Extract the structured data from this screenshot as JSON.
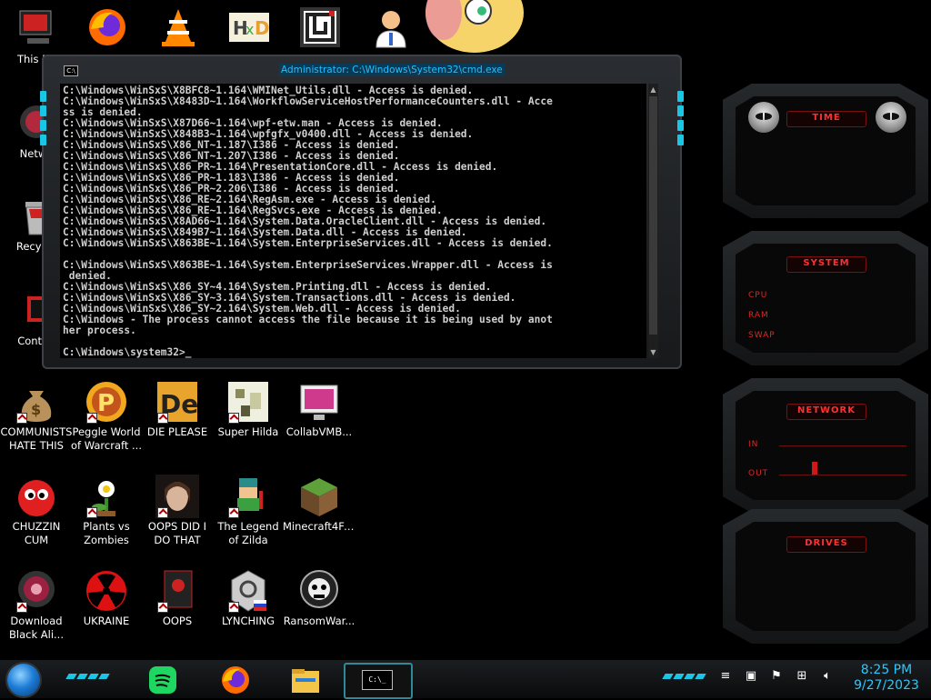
{
  "desktop": {
    "top_row_partial": [
      {
        "label": "This PC",
        "icon": "this-pc-icon"
      },
      {
        "label": "",
        "icon": "firefox-icon"
      },
      {
        "label": "",
        "icon": "vlc-icon"
      },
      {
        "label": "",
        "icon": "hxd-icon"
      },
      {
        "label": "",
        "icon": "maze-icon"
      },
      {
        "label": "",
        "icon": "doctor-icon"
      },
      {
        "label": "",
        "icon": "cartoon-character-icon"
      }
    ],
    "left_column": [
      {
        "label": "Netwo",
        "icon": "network-icon"
      },
      {
        "label": "Recycle",
        "icon": "recycle-bin-icon"
      },
      {
        "label": "Control",
        "icon": "control-panel-icon"
      }
    ],
    "grid": [
      {
        "label": "COMMUNISTS HATE THIS G...",
        "icon": "money-bag-icon"
      },
      {
        "label": "Peggle World of Warcraft ...",
        "icon": "peggle-icon"
      },
      {
        "label": "DIE PLEASE",
        "icon": "die-icon"
      },
      {
        "label": "Super Hilda",
        "icon": "super-hilda-icon"
      },
      {
        "label": "CollabVMB...",
        "icon": "collabvm-icon"
      },
      {
        "label": "CHUZZIN CUM",
        "icon": "chuzzle-icon"
      },
      {
        "label": "Plants vs Zombies",
        "icon": "plants-vs-zombies-icon"
      },
      {
        "label": "OOPS DID I DO THAT",
        "icon": "portrait-icon"
      },
      {
        "label": "The Legend of Zilda",
        "icon": "zelda-icon"
      },
      {
        "label": "Minecraft4Fr...",
        "icon": "minecraft-icon"
      },
      {
        "label": "Download Black Ali...",
        "icon": "alienware-icon"
      },
      {
        "label": "UKRAINE",
        "icon": "radiation-icon"
      },
      {
        "label": "OOPS",
        "icon": "oops-icon"
      },
      {
        "label": "LYNCHING",
        "icon": "lynching-icon"
      },
      {
        "label": "RansomWar...",
        "icon": "skull-icon"
      }
    ]
  },
  "console": {
    "title": "Administrator: C:\\Windows\\System32\\cmd.exe",
    "icon_label": "C:\\",
    "lines": [
      "C:\\Windows\\WinSxS\\X8BFC8~1.164\\WMINet_Utils.dll - Access is denied.",
      "C:\\Windows\\WinSxS\\X8483D~1.164\\WorkflowServiceHostPerformanceCounters.dll - Acce",
      "ss is denied.",
      "C:\\Windows\\WinSxS\\X87D66~1.164\\wpf-etw.man - Access is denied.",
      "C:\\Windows\\WinSxS\\X848B3~1.164\\wpfgfx_v0400.dll - Access is denied.",
      "C:\\Windows\\WinSxS\\X86_NT~1.187\\I386 - Access is denied.",
      "C:\\Windows\\WinSxS\\X86_NT~1.207\\I386 - Access is denied.",
      "C:\\Windows\\WinSxS\\X86_PR~1.164\\PresentationCore.dll - Access is denied.",
      "C:\\Windows\\WinSxS\\X86_PR~1.183\\I386 - Access is denied.",
      "C:\\Windows\\WinSxS\\X86_PR~2.206\\I386 - Access is denied.",
      "C:\\Windows\\WinSxS\\X86_RE~2.164\\RegAsm.exe - Access is denied.",
      "C:\\Windows\\WinSxS\\X86_RE~1.164\\RegSvcs.exe - Access is denied.",
      "C:\\Windows\\WinSxS\\X8AD66~1.164\\System.Data.OracleClient.dll - Access is denied.",
      "C:\\Windows\\WinSxS\\X849B7~1.164\\System.Data.dll - Access is denied.",
      "C:\\Windows\\WinSxS\\X863BE~1.164\\System.EnterpriseServices.dll - Access is denied.",
      "",
      "C:\\Windows\\WinSxS\\X863BE~1.164\\System.EnterpriseServices.Wrapper.dll - Access is",
      " denied.",
      "C:\\Windows\\WinSxS\\X86_SY~4.164\\System.Printing.dll - Access is denied.",
      "C:\\Windows\\WinSxS\\X86_SY~3.164\\System.Transactions.dll - Access is denied.",
      "C:\\Windows\\WinSxS\\X86_SY~2.164\\System.Web.dll - Access is denied.",
      "C:\\Windows - The process cannot access the file because it is being used by anot",
      "her process.",
      "",
      "C:\\Windows\\system32>_"
    ]
  },
  "gadgets": {
    "time": {
      "title": "TIME"
    },
    "system": {
      "title": "SYSTEM",
      "rows": [
        "CPU",
        "RAM",
        "SWAP"
      ]
    },
    "network": {
      "title": "NETWORK",
      "rows": [
        "IN",
        "OUT"
      ]
    },
    "drives": {
      "title": "DRIVES"
    }
  },
  "taskbar": {
    "apps": [
      "spotify-icon",
      "firefox-icon",
      "file-explorer-icon",
      "cmd-icon"
    ],
    "cmd_label": "C:\\_",
    "tray": [
      "chevron-icon",
      "nvidia-icon",
      "flag-icon",
      "network-icon",
      "volume-icon"
    ],
    "time": "8:25 PM",
    "date": "9/27/2023"
  },
  "colors": {
    "accent": "#19c6e6",
    "alien_red": "#e02525",
    "clock": "#29c8ff"
  }
}
